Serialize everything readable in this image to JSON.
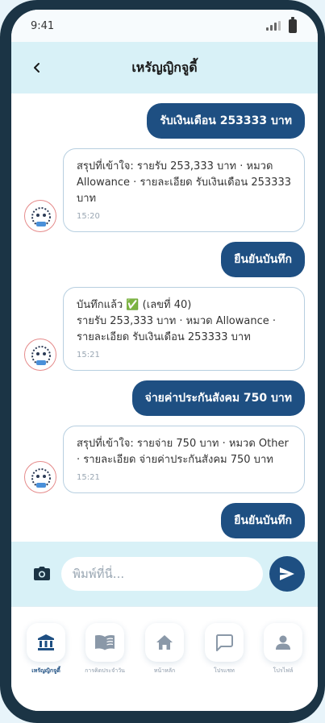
{
  "status_bar": {
    "time": "9:41"
  },
  "header": {
    "title": "เหรัญญิกจูดี้"
  },
  "messages": [
    {
      "type": "user",
      "text": "รับเงินเดือน 253333 บาท"
    },
    {
      "type": "bot",
      "text": "สรุปที่เข้าใจ: รายรับ 253,333 บาท · หมวด Allowance · รายละเอียด รับเงินเดือน 253333 บาท",
      "time": "15:20"
    },
    {
      "type": "user",
      "text": "ยืนยันบันทึก"
    },
    {
      "type": "bot",
      "text": "บันทึกแล้ว ✅ (เลขที่ 40)\nรายรับ 253,333 บาท · หมวด Allowance · รายละเอียด รับเงินเดือน 253333 บาท",
      "time": "15:21"
    },
    {
      "type": "user",
      "text": "จ่ายค่าประกันสังคม 750 บาท"
    },
    {
      "type": "bot",
      "text": "สรุปที่เข้าใจ: รายจ่าย 750 บาท · หมวด Other · รายละเอียด จ่ายค่าประกันสังคม 750 บาท",
      "time": "15:21"
    },
    {
      "type": "user",
      "text": "ยืนยันบันทึก"
    }
  ],
  "composer": {
    "placeholder": "พิมพ์ที่นี่..."
  },
  "nav": [
    {
      "label": "เหรัญญิกจูดี้",
      "icon": "bank-icon",
      "active": true
    },
    {
      "label": "การคิดประจำวัน",
      "icon": "book-icon",
      "active": false
    },
    {
      "label": "หน้าหลัก",
      "icon": "home-icon",
      "active": false
    },
    {
      "label": "โปรแชท",
      "icon": "chat-icon",
      "active": false
    },
    {
      "label": "โปรไฟล์",
      "icon": "person-icon",
      "active": false
    }
  ],
  "colors": {
    "accent": "#1e4f82",
    "header_bg": "#d8f1f7",
    "frame": "#1b3445"
  }
}
